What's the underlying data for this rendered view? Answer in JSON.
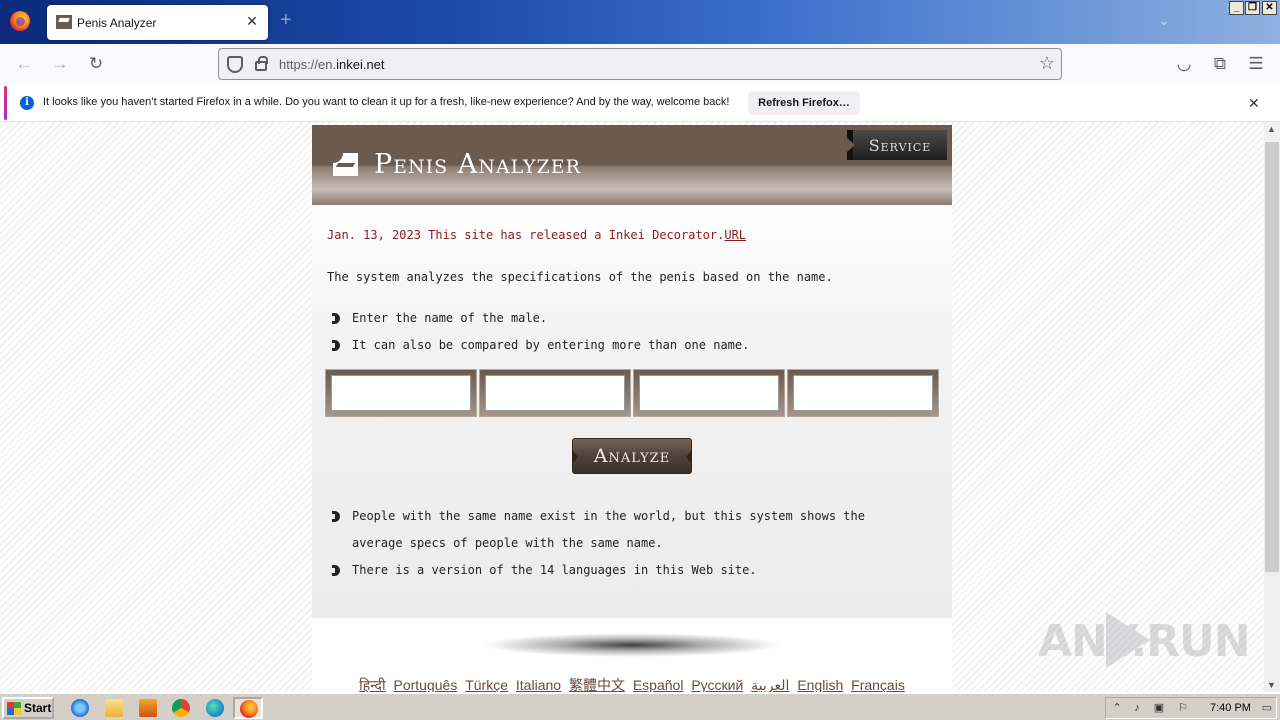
{
  "browser": {
    "tab_title": "Penis Analyzer",
    "url_prefix": "https://en.",
    "url_domain": "inkei.net",
    "notification": {
      "text": "It looks like you haven’t started Firefox in a while. Do you want to clean it up for a fresh, like-new experience? And by the way, welcome back!",
      "refresh_label": "Refresh Firefox…"
    }
  },
  "site": {
    "title": "Penis Analyzer",
    "service_label": "Service",
    "news_text": "Jan. 13, 2023 This site has released a Inkei Decorator.",
    "news_link": "URL",
    "intro": "The system analyzes the specifications of the penis based on the name.",
    "instructions": [
      "Enter the name of the male.",
      "It can also be compared by entering more than one name."
    ],
    "name_inputs": [
      "",
      "",
      "",
      ""
    ],
    "analyze_label": "Analyze",
    "notes": [
      "People with the same name exist in the world, but this system shows the average specs of people with the same name.",
      "There is a version of the 14 languages in this Web site."
    ],
    "languages": [
      "हिन्दी",
      "Português",
      "Türkçe",
      "Italiano",
      "繁體中文",
      "Español",
      "Русский",
      "العربية",
      "English",
      "Français"
    ]
  },
  "watermark": "ANY.RUN",
  "taskbar": {
    "start_label": "Start",
    "clock": "7:40 PM"
  }
}
